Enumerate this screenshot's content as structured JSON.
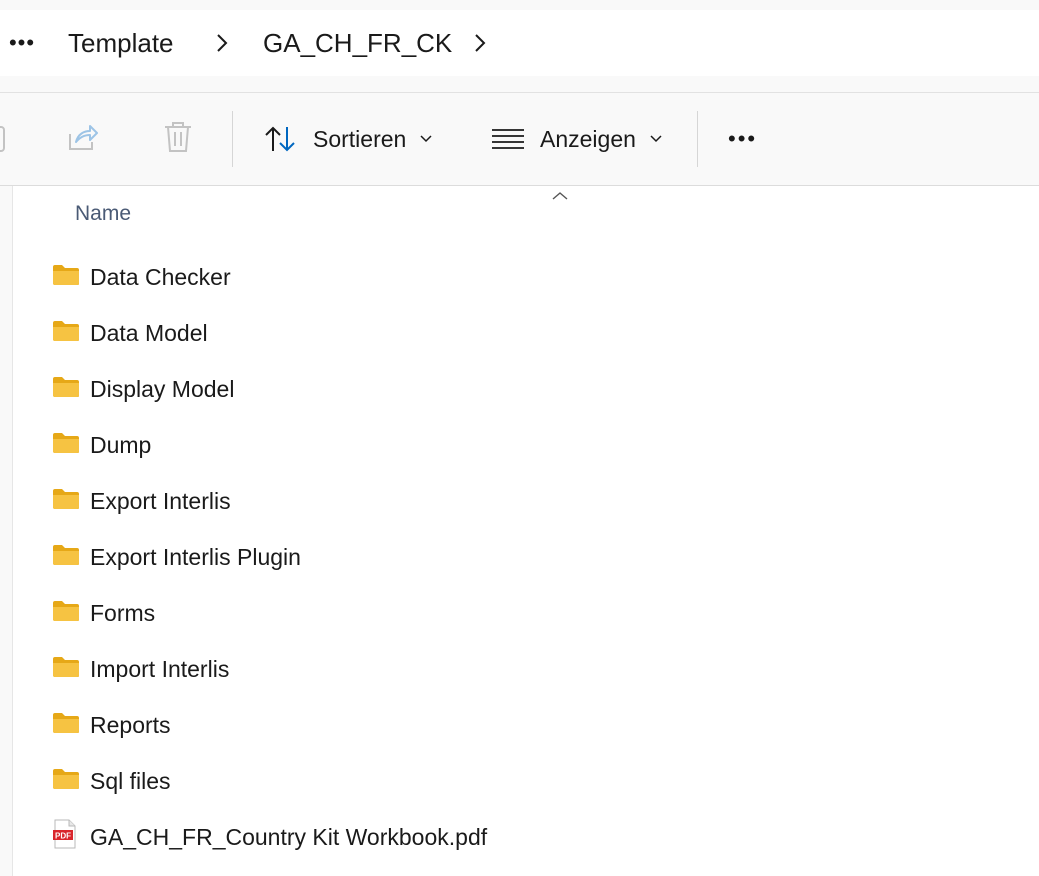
{
  "breadcrumb": {
    "more_label": "•••",
    "items": [
      {
        "label": "Template"
      },
      {
        "label": "GA_CH_FR_CK"
      }
    ]
  },
  "toolbar": {
    "sort_label": "Sortieren",
    "view_label": "Anzeigen",
    "more_label": "•••"
  },
  "columns": {
    "name": "Name"
  },
  "files": [
    {
      "name": "Data Checker",
      "type": "folder"
    },
    {
      "name": "Data Model",
      "type": "folder"
    },
    {
      "name": "Display Model",
      "type": "folder"
    },
    {
      "name": "Dump",
      "type": "folder"
    },
    {
      "name": "Export Interlis",
      "type": "folder"
    },
    {
      "name": "Export Interlis Plugin",
      "type": "folder"
    },
    {
      "name": "Forms",
      "type": "folder"
    },
    {
      "name": "Import Interlis",
      "type": "folder"
    },
    {
      "name": "Reports",
      "type": "folder"
    },
    {
      "name": "Sql files",
      "type": "folder"
    },
    {
      "name": "GA_CH_FR_Country Kit Workbook.pdf",
      "type": "pdf",
      "badge": "PDF"
    }
  ],
  "colors": {
    "folder": "#f6c342",
    "folder_dark": "#e6a817",
    "pdf_red": "#d9262c",
    "accent": "#0067c0",
    "header_text": "#4a5a75"
  }
}
